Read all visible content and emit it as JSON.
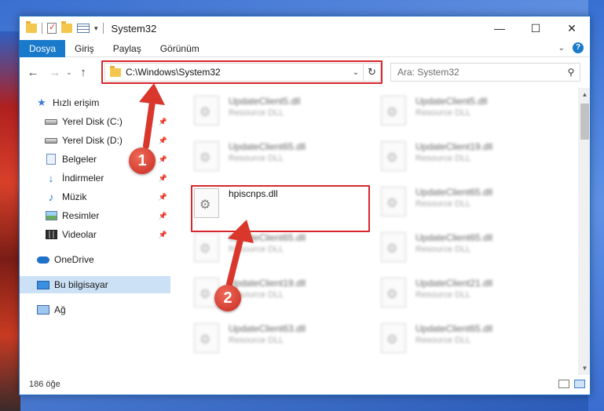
{
  "window": {
    "title": "System32",
    "controls": {
      "minimize": "—",
      "maximize": "☐",
      "close": "✕"
    }
  },
  "ribbon": {
    "tabs": [
      "Dosya",
      "Giriş",
      "Paylaş",
      "Görünüm"
    ],
    "active_tab": "Dosya",
    "expand_icon": "chevron-down-icon",
    "help_label": "?"
  },
  "address": {
    "path": "C:\\Windows\\System32",
    "back": "←",
    "forward": "→",
    "recent": "⌄",
    "up": "↑",
    "refresh": "↻",
    "dropdown": "⌄"
  },
  "search": {
    "placeholder": "Ara: System32",
    "icon": "⚲"
  },
  "nav": {
    "items": [
      {
        "label": "Hızlı erişim",
        "icon": "star-icon"
      },
      {
        "label": "Yerel Disk (C:)",
        "icon": "drive-icon",
        "pinned": true
      },
      {
        "label": "Yerel Disk (D:)",
        "icon": "drive-icon",
        "pinned": true
      },
      {
        "label": "Belgeler",
        "icon": "documents-icon",
        "pinned": true
      },
      {
        "label": "İndirmeler",
        "icon": "download-icon",
        "pinned": true
      },
      {
        "label": "Müzik",
        "icon": "music-icon",
        "pinned": true
      },
      {
        "label": "Resimler",
        "icon": "pictures-icon",
        "pinned": true
      },
      {
        "label": "Videolar",
        "icon": "videos-icon",
        "pinned": true
      },
      {
        "label": "OneDrive",
        "icon": "cloud-icon"
      },
      {
        "label": "Bu bilgisayar",
        "icon": "computer-icon",
        "selected": true
      },
      {
        "label": "Ağ",
        "icon": "network-icon"
      }
    ]
  },
  "files": [
    {
      "name": "UpdateClient5.dll",
      "type": "Resource DLL"
    },
    {
      "name": "UpdateClient5.dll",
      "type": "Resource DLL"
    },
    {
      "name": "UpdateClient65.dll",
      "type": "Resource DLL"
    },
    {
      "name": "UpdateClient19.dll",
      "type": "Resource DLL"
    },
    {
      "name": "hpiscnps.dll",
      "type": ""
    },
    {
      "name": "UpdateClient65.dll",
      "type": "Resource DLL"
    },
    {
      "name": "UpdateClient65.dll",
      "type": "Resource DLL"
    },
    {
      "name": "UpdateClient65.dll",
      "type": "Resource DLL"
    },
    {
      "name": "UpdateClient19.dll",
      "type": "Resource DLL"
    },
    {
      "name": "UpdateClient21.dll",
      "type": "Resource DLL"
    },
    {
      "name": "UpdateClient63.dll",
      "type": "Resource DLL"
    },
    {
      "name": "UpdateClient65.dll",
      "type": "Resource DLL"
    }
  ],
  "status": {
    "count": "186 öğe"
  },
  "annotations": {
    "step1": "1",
    "step2": "2"
  },
  "colors": {
    "accent": "#1979ca",
    "highlight": "#d9262c",
    "badge": "#d9362c"
  }
}
